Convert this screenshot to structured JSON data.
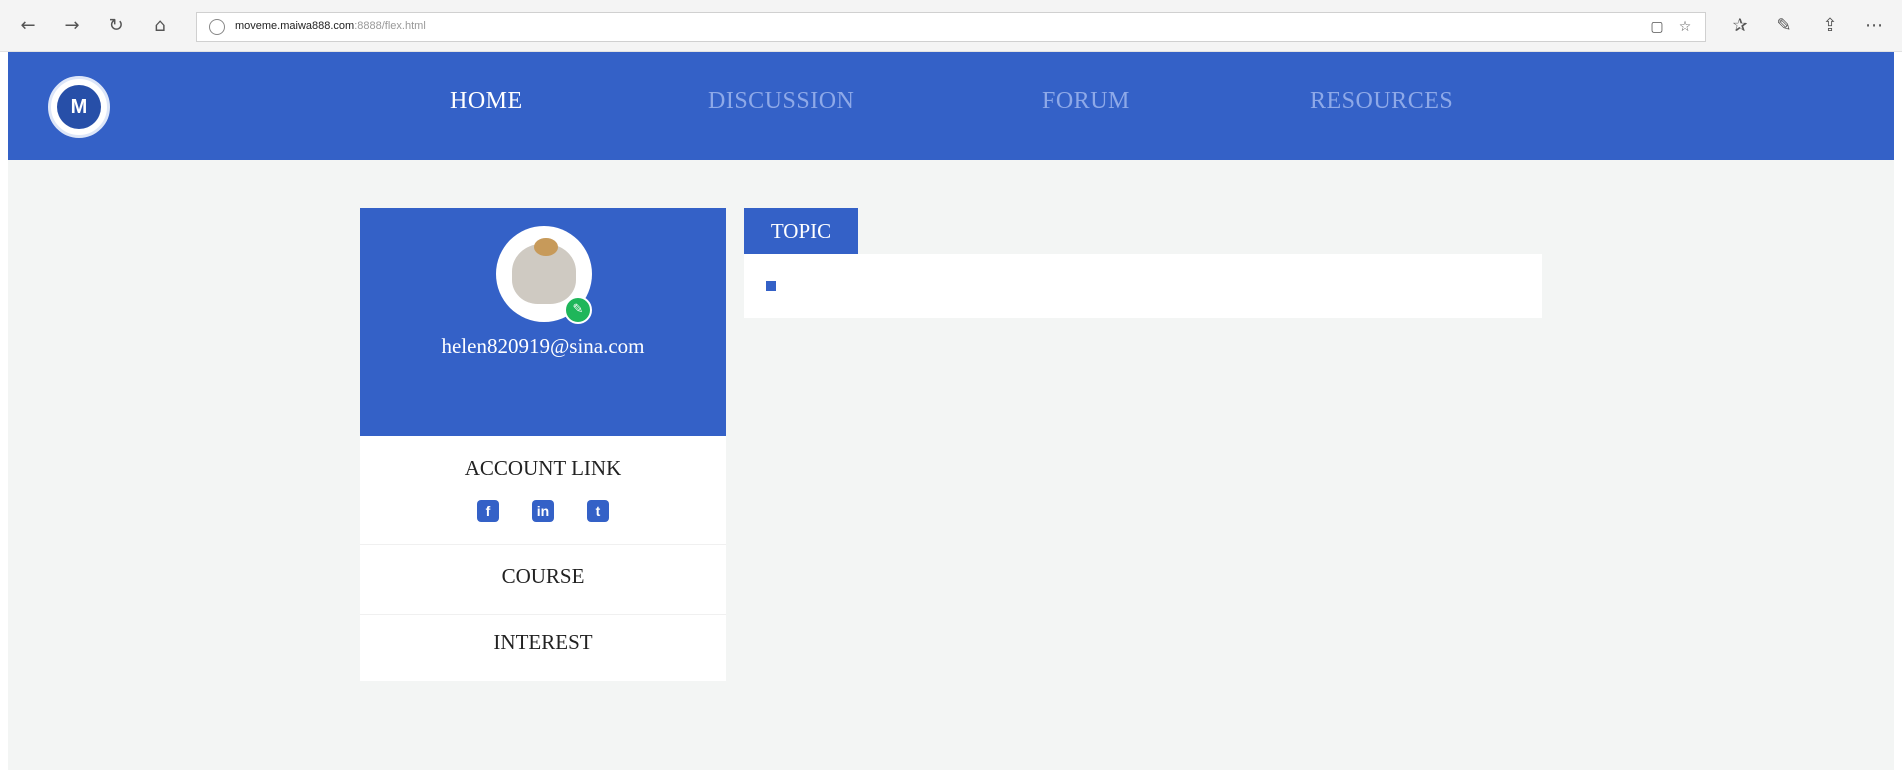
{
  "browser": {
    "url_host": "moveme.maiwa888.com",
    "url_path": ":8888/flex.html",
    "icons": [
      "back-icon",
      "forward-icon",
      "refresh-icon",
      "home-icon",
      "reading-view-icon",
      "favorite-star-icon",
      "favorites-icon",
      "pen-icon",
      "share-icon",
      "more-icon"
    ]
  },
  "header": {
    "logo_text": "M",
    "nav": [
      "HOME",
      "DISCUSSION",
      "FORUM",
      "RESOURCES"
    ],
    "active_nav": "HOME"
  },
  "profile": {
    "email": "helen820919@sina.com",
    "edit_icon": "pencil-icon"
  },
  "menu": {
    "account_link": "ACCOUNT LINK",
    "social": [
      "facebook-icon",
      "linkedin-icon",
      "twitter-icon"
    ],
    "course": "COURSE",
    "interest": "INTEREST"
  },
  "topic": {
    "tab_label": "TOPIC"
  },
  "colors": {
    "brand_blue": "#3461c7",
    "edit_green": "#1fb65a",
    "page_bg": "#f3f5f4"
  }
}
